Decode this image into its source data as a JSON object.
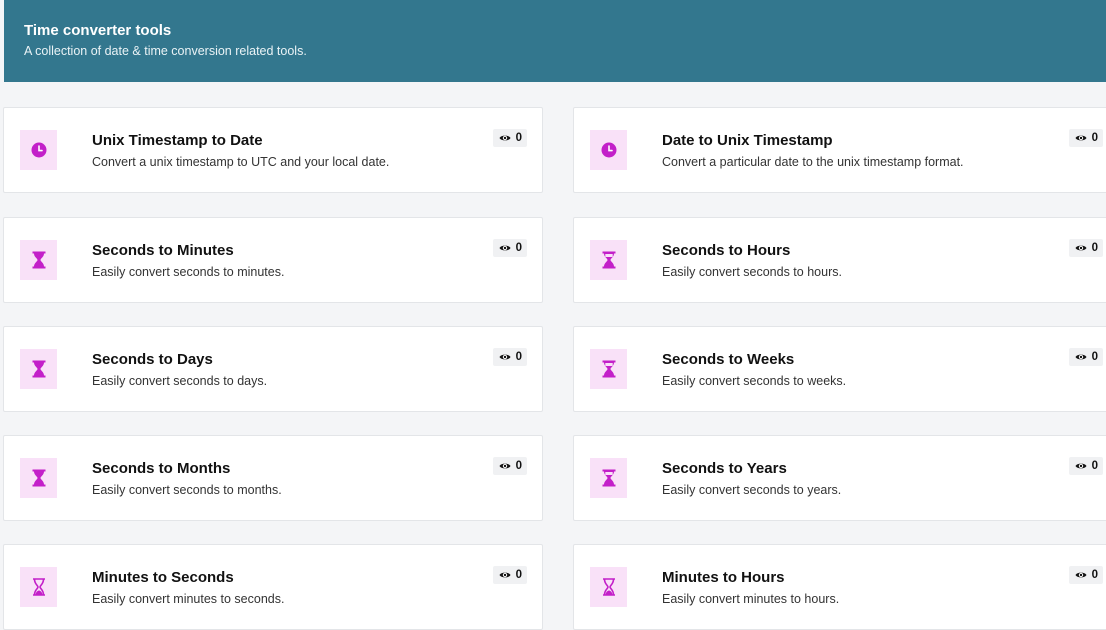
{
  "header": {
    "title": "Time converter tools",
    "subtitle": "A collection of date & time conversion related tools."
  },
  "colors": {
    "header_bg": "#33778e",
    "icon_accent": "#c320c9",
    "icon_bg": "#f9e1f8"
  },
  "tools": [
    {
      "title": "Unix Timestamp to Date",
      "description": "Convert a unix timestamp to UTC and your local date.",
      "views": "0",
      "icon": "clock-icon"
    },
    {
      "title": "Date to Unix Timestamp",
      "description": "Convert a particular date to the unix timestamp format.",
      "views": "0",
      "icon": "clock-icon"
    },
    {
      "title": "Seconds to Minutes",
      "description": "Easily convert seconds to minutes.",
      "views": "0",
      "icon": "hourglass-icon"
    },
    {
      "title": "Seconds to Hours",
      "description": "Easily convert seconds to hours.",
      "views": "0",
      "icon": "hourglass-icon"
    },
    {
      "title": "Seconds to Days",
      "description": "Easily convert seconds to days.",
      "views": "0",
      "icon": "hourglass-icon"
    },
    {
      "title": "Seconds to Weeks",
      "description": "Easily convert seconds to weeks.",
      "views": "0",
      "icon": "hourglass-icon"
    },
    {
      "title": "Seconds to Months",
      "description": "Easily convert seconds to months.",
      "views": "0",
      "icon": "hourglass-icon"
    },
    {
      "title": "Seconds to Years",
      "description": "Easily convert seconds to years.",
      "views": "0",
      "icon": "hourglass-icon"
    },
    {
      "title": "Minutes to Seconds",
      "description": "Easily convert minutes to seconds.",
      "views": "0",
      "icon": "hourglass-outline-icon"
    },
    {
      "title": "Minutes to Hours",
      "description": "Easily convert minutes to hours.",
      "views": "0",
      "icon": "hourglass-outline-icon"
    }
  ]
}
